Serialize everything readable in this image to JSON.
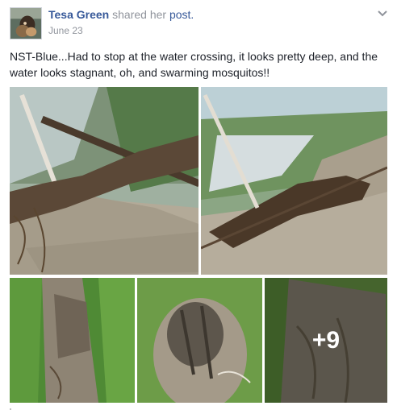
{
  "post": {
    "author": "Tesa Green",
    "shared_text": "shared her",
    "post_link": "post.",
    "timestamp": "June 23",
    "text": "NST-Blue...Had to stop at the water crossing, it looks pretty deep, and the water looks stagnant, oh, and swarming mosquitos!!",
    "more_photos_label": "+9"
  },
  "icons": {
    "avatar": "profile-photo",
    "menu": "chevron-down-icon"
  },
  "colors": {
    "author_link": "#365899",
    "meta_text": "#90949c",
    "body_text": "#1d2129"
  }
}
